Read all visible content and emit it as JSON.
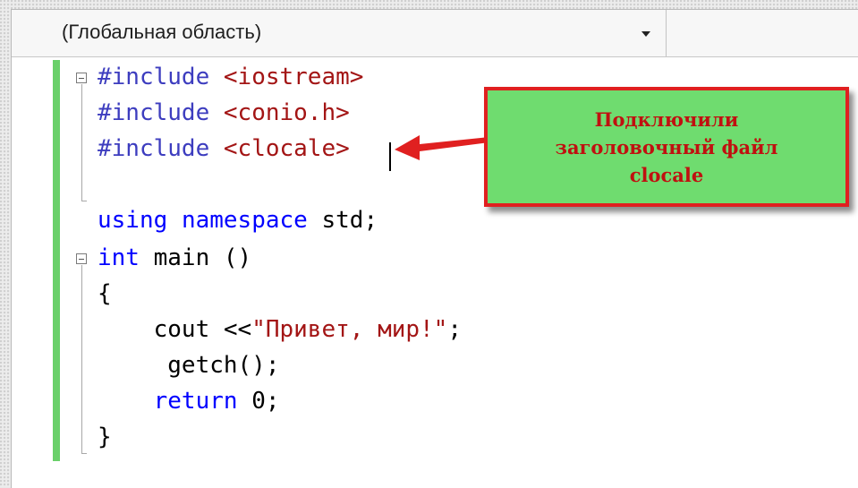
{
  "navigation": {
    "scope_label": "(Глобальная область)",
    "dropdown_icon": "chevron-down-icon",
    "member_label": ""
  },
  "code": {
    "lines": [
      {
        "tokens": [
          {
            "text": "#include",
            "kind": "preprocessor"
          },
          {
            "text": " ",
            "kind": "plain"
          },
          {
            "text": "<iostream>",
            "kind": "include"
          }
        ]
      },
      {
        "tokens": [
          {
            "text": "#include",
            "kind": "preprocessor"
          },
          {
            "text": " ",
            "kind": "plain"
          },
          {
            "text": "<conio.h>",
            "kind": "include"
          }
        ]
      },
      {
        "tokens": [
          {
            "text": "#include",
            "kind": "preprocessor"
          },
          {
            "text": " ",
            "kind": "plain"
          },
          {
            "text": "<clocale>",
            "kind": "include"
          }
        ]
      },
      {
        "tokens": []
      },
      {
        "tokens": [
          {
            "text": "using",
            "kind": "keyword"
          },
          {
            "text": " ",
            "kind": "plain"
          },
          {
            "text": "namespace",
            "kind": "keyword"
          },
          {
            "text": " std;",
            "kind": "plain"
          }
        ]
      },
      {
        "tokens": [
          {
            "text": "int",
            "kind": "keyword"
          },
          {
            "text": " main ()",
            "kind": "plain"
          }
        ]
      },
      {
        "tokens": [
          {
            "text": "{",
            "kind": "plain"
          }
        ]
      },
      {
        "tokens": [
          {
            "text": "    cout <<",
            "kind": "plain"
          },
          {
            "text": "\"Привет, мир!\"",
            "kind": "string"
          },
          {
            "text": ";",
            "kind": "plain"
          }
        ]
      },
      {
        "tokens": [
          {
            "text": "     getch();",
            "kind": "plain"
          }
        ]
      },
      {
        "tokens": [
          {
            "text": "    ",
            "kind": "plain"
          },
          {
            "text": "return",
            "kind": "keyword"
          },
          {
            "text": " 0;",
            "kind": "plain"
          }
        ]
      },
      {
        "tokens": [
          {
            "text": "}",
            "kind": "plain"
          }
        ]
      }
    ]
  },
  "callout": {
    "line1": "Подключили",
    "line2": "заголовочный файл",
    "line3": "clocale"
  },
  "colors": {
    "keyword": "#0000ff",
    "preprocessor": "#3d3dbf",
    "include": "#a31515",
    "string": "#a31515",
    "change_bar": "#6ad06a",
    "callout_bg": "#6fdc6f",
    "callout_border": "#e02020",
    "callout_text": "#c01010"
  }
}
